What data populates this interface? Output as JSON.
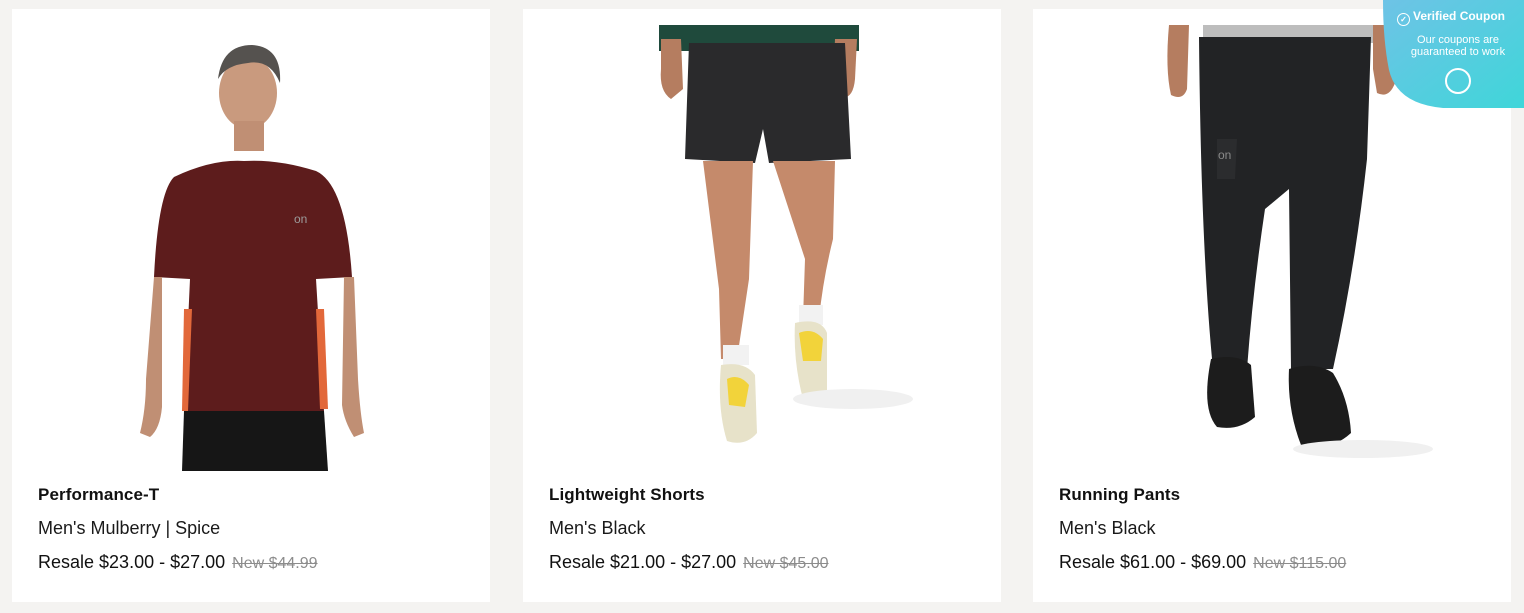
{
  "products": [
    {
      "name": "Performance-T",
      "variant": "Men's Mulberry | Spice",
      "price": "Resale $23.00 - $27.00",
      "original_price": "New $44.99",
      "image_icon": "man-in-mulberry-tshirt"
    },
    {
      "name": "Lightweight Shorts",
      "variant": "Men's Black",
      "price": "Resale $21.00 - $27.00",
      "original_price": "New $45.00",
      "image_icon": "legs-in-black-shorts"
    },
    {
      "name": "Running Pants",
      "variant": "Men's Black",
      "price": "Resale $61.00 - $69.00",
      "original_price": "New $115.00",
      "image_icon": "legs-in-black-running-pants"
    }
  ],
  "coupon": {
    "title": "Verified Coupon",
    "message": "Our coupons are guaranteed to work",
    "icon": "coupon-tag-icon"
  },
  "colors": {
    "background": "#f4f3f1",
    "card": "#ffffff",
    "coupon_gradient_start": "#6ec3e6",
    "coupon_gradient_end": "#3fd6d9",
    "strikethrough": "#8c8c8c"
  }
}
